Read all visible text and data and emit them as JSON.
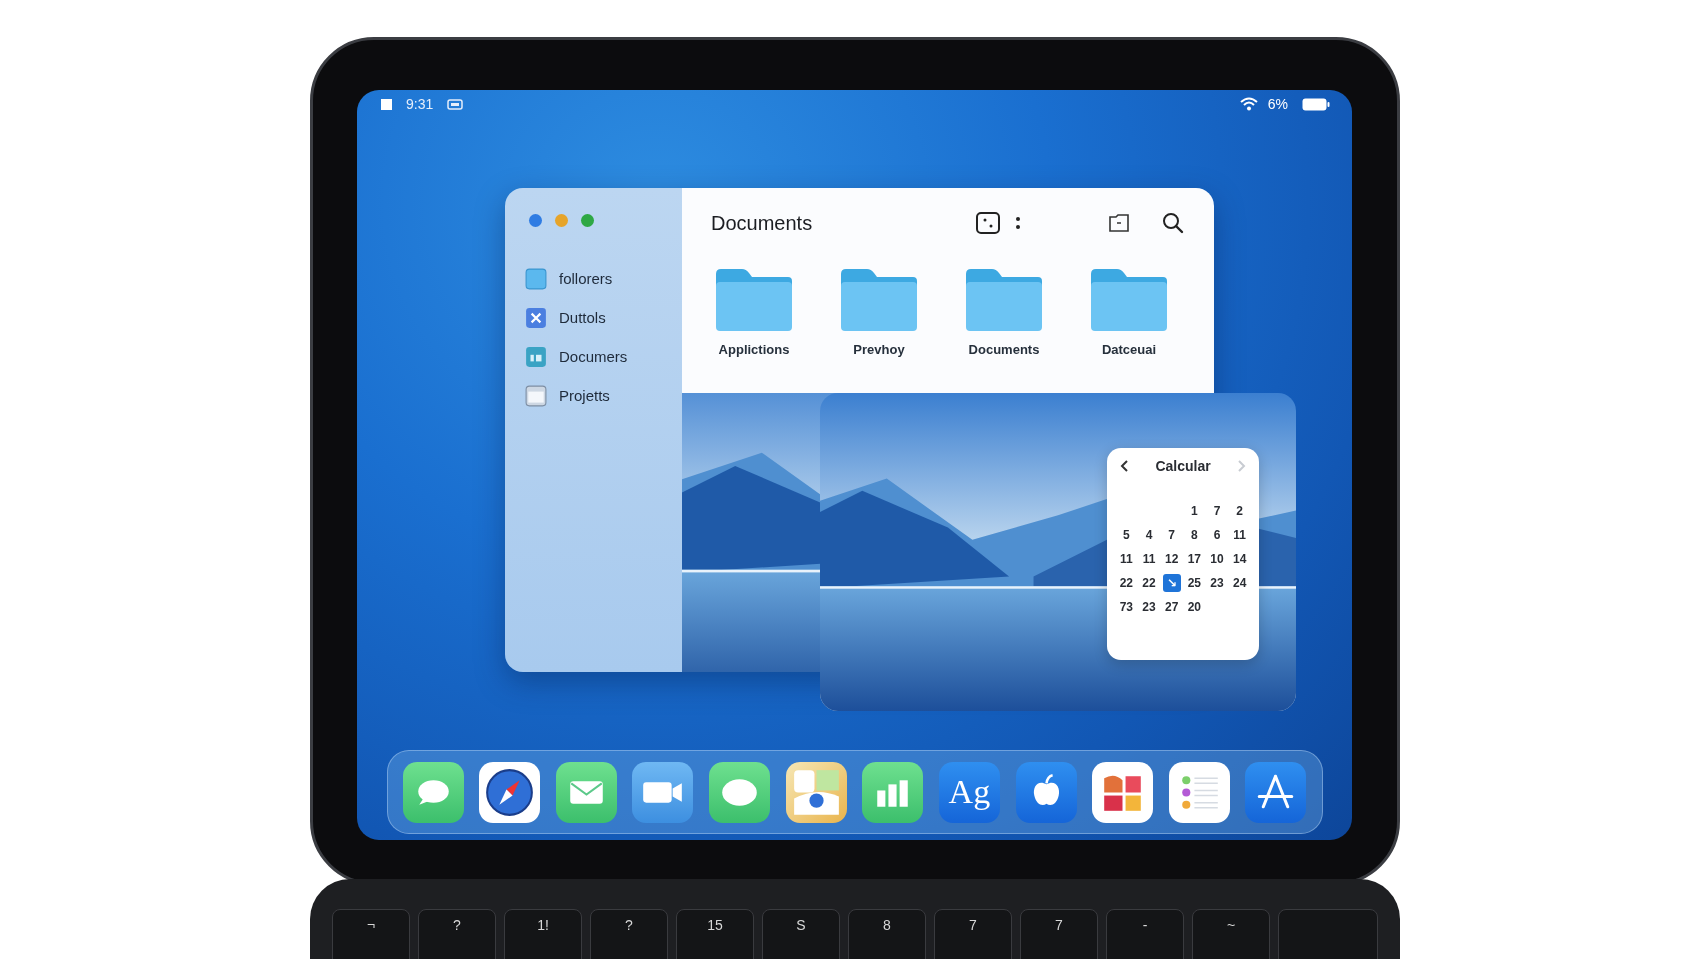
{
  "status_bar": {
    "time": "9:31",
    "battery": "6%"
  },
  "finder": {
    "title": "Documents",
    "sidebar": {
      "items": [
        {
          "label": "follorers",
          "kind": "folder"
        },
        {
          "label": "Duttols",
          "kind": "tools"
        },
        {
          "label": "Documers",
          "kind": "doc"
        },
        {
          "label": "Projetts",
          "kind": "window"
        }
      ]
    },
    "folders": [
      {
        "label": "Applictions"
      },
      {
        "label": "Prevhoy"
      },
      {
        "label": "Documents"
      },
      {
        "label": "Datceuai"
      }
    ]
  },
  "calendar": {
    "title": "Calcular",
    "weeks": [
      [
        {
          "day": "1",
          "selected": false
        },
        {
          "day": "7",
          "selected": false
        },
        {
          "day": "2",
          "selected": false
        }
      ],
      [
        {
          "day": "5",
          "selected": false
        },
        {
          "day": "4",
          "selected": false
        },
        {
          "day": "7",
          "selected": false
        },
        {
          "day": "8",
          "selected": false
        },
        {
          "day": "6",
          "selected": false
        },
        {
          "day": "11",
          "selected": false
        }
      ],
      [
        {
          "day": "11",
          "selected": false
        },
        {
          "day": "11",
          "selected": false
        },
        {
          "day": "12",
          "selected": false
        },
        {
          "day": "17",
          "selected": false
        },
        {
          "day": "10",
          "selected": false
        },
        {
          "day": "14",
          "selected": false
        }
      ],
      [
        {
          "day": "22",
          "selected": false
        },
        {
          "day": "22",
          "selected": false
        },
        {
          "day": "↘",
          "selected": true
        },
        {
          "day": "25",
          "selected": false
        },
        {
          "day": "23",
          "selected": false
        },
        {
          "day": "24",
          "selected": false
        }
      ],
      [
        {
          "day": "73",
          "selected": false
        },
        {
          "day": "23",
          "selected": false
        },
        {
          "day": "27",
          "selected": false
        },
        {
          "day": "20",
          "selected": false
        }
      ]
    ]
  },
  "dock": [
    {
      "kind": "chat"
    },
    {
      "kind": "compass"
    },
    {
      "kind": "mail"
    },
    {
      "kind": "video"
    },
    {
      "kind": "bubble"
    },
    {
      "kind": "collage"
    },
    {
      "kind": "chart"
    },
    {
      "kind": "text",
      "label": "Ag"
    },
    {
      "kind": "apple"
    },
    {
      "kind": "blocks"
    },
    {
      "kind": "list"
    },
    {
      "kind": "store"
    }
  ],
  "keyboard": {
    "keys": [
      {
        "label": "¬"
      },
      {
        "label": "?"
      },
      {
        "label": "1!"
      },
      {
        "label": "?"
      },
      {
        "label": "15"
      },
      {
        "label": "S"
      },
      {
        "label": "8"
      },
      {
        "label": "7"
      },
      {
        "label": "7"
      },
      {
        "label": "-"
      },
      {
        "label": "~"
      },
      {
        "kind": "wide"
      }
    ]
  }
}
